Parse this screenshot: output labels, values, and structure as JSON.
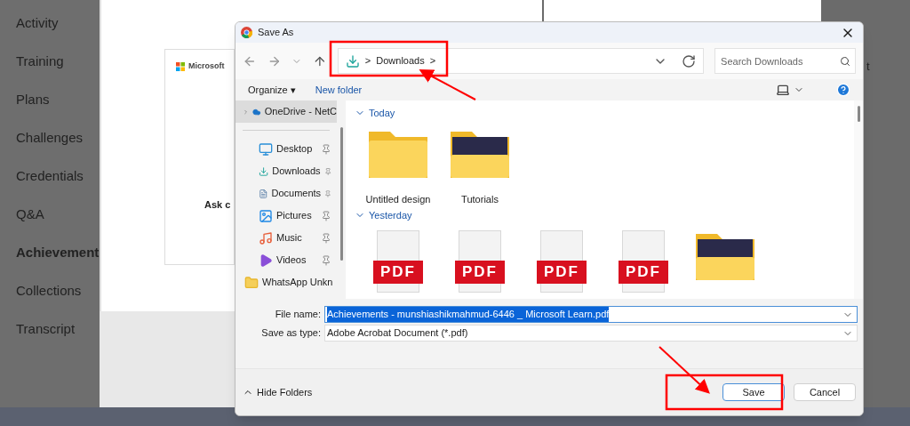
{
  "sidebar": {
    "items": [
      {
        "label": "Activity",
        "selected": false
      },
      {
        "label": "Training",
        "selected": false
      },
      {
        "label": "Plans",
        "selected": false
      },
      {
        "label": "Challenges",
        "selected": false
      },
      {
        "label": "Credentials",
        "selected": false
      },
      {
        "label": "Q&A",
        "selected": false
      },
      {
        "label": "Achievement",
        "selected": true
      },
      {
        "label": "Collections",
        "selected": false
      },
      {
        "label": "Transcript",
        "selected": false
      }
    ]
  },
  "card": {
    "logo_text": "Microsoft",
    "heading": "Ask c"
  },
  "right_panel": {
    "text": "t"
  },
  "dialog": {
    "title": "Save As",
    "address": {
      "separator_1": ">",
      "folder": "Downloads",
      "separator_2": ">"
    },
    "search": {
      "placeholder": "Search Downloads"
    },
    "toolbar": {
      "organize": "Organize ▾",
      "new_folder": "New folder"
    },
    "nav_pane": [
      {
        "label": "OneDrive - NetC",
        "kind": "cloud",
        "selected": true,
        "pinned": false
      },
      {
        "label": "Desktop",
        "kind": "desktop",
        "selected": false,
        "pinned": true
      },
      {
        "label": "Downloads",
        "kind": "downloads",
        "selected": false,
        "pinned": true
      },
      {
        "label": "Documents",
        "kind": "documents",
        "selected": false,
        "pinned": true
      },
      {
        "label": "Pictures",
        "kind": "pictures",
        "selected": false,
        "pinned": true
      },
      {
        "label": "Music",
        "kind": "music",
        "selected": false,
        "pinned": true
      },
      {
        "label": "Videos",
        "kind": "videos",
        "selected": false,
        "pinned": true
      },
      {
        "label": "WhatsApp Unkn",
        "kind": "folder",
        "selected": false,
        "pinned": false
      }
    ],
    "groups": [
      {
        "title": "Today",
        "items": [
          {
            "kind": "folder",
            "name": "Untitled design"
          },
          {
            "kind": "folder-thumbnail",
            "name": "Tutorials"
          }
        ]
      },
      {
        "title": "Yesterday",
        "items": [
          {
            "kind": "pdf",
            "label": "PDF"
          },
          {
            "kind": "pdf",
            "label": "PDF"
          },
          {
            "kind": "pdf",
            "label": "PDF"
          },
          {
            "kind": "pdf",
            "label": "PDF"
          },
          {
            "kind": "folder-thumbnail"
          }
        ]
      }
    ],
    "file_name": {
      "label": "File name:",
      "value": "Achievements - munshiashikmahmud-6446 _ Microsoft Learn.pdf"
    },
    "save_as_type": {
      "label": "Save as type:",
      "value": "Adobe Acrobat Document (*.pdf)"
    },
    "hide_folders": "Hide Folders",
    "buttons": [
      {
        "label": "Save",
        "kind": "primary"
      },
      {
        "label": "Cancel",
        "kind": "secondary"
      }
    ]
  }
}
